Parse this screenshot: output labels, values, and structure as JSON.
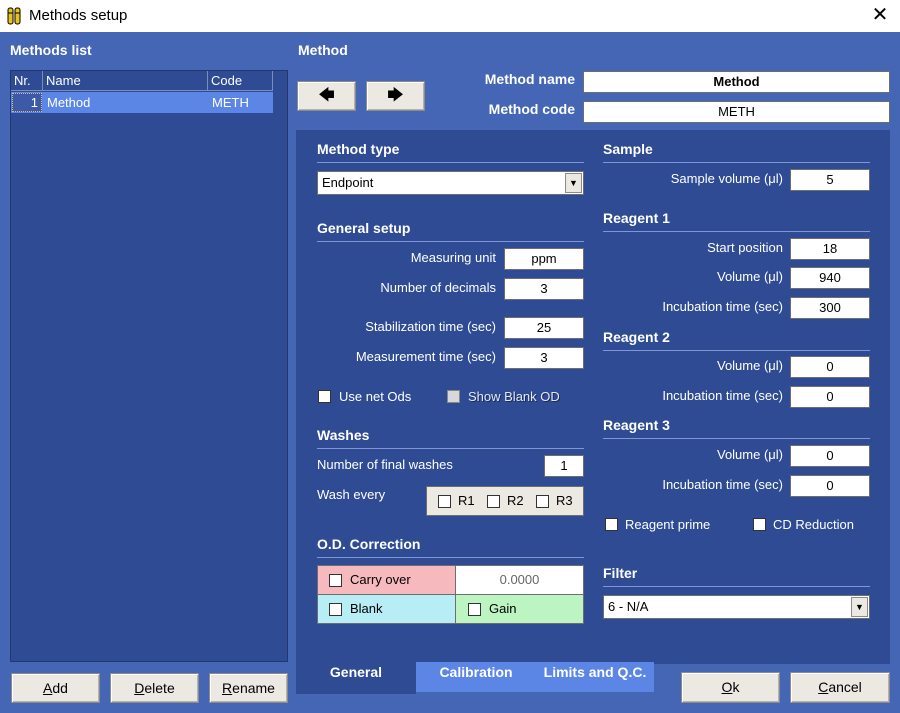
{
  "window": {
    "title": "Methods setup",
    "close_glyph": "✕"
  },
  "methods_list": {
    "title": "Methods list",
    "columns": [
      "Nr.",
      "Name",
      "Code"
    ],
    "rows": [
      {
        "nr": "1",
        "name": "Method",
        "code": "METH"
      }
    ]
  },
  "method": {
    "title": "Method",
    "prev_glyph": "🡄",
    "next_glyph": "🡆",
    "name_label": "Method name",
    "name_value": "Method",
    "code_label": "Method code",
    "code_value": "METH"
  },
  "method_type": {
    "title": "Method type",
    "selected": "Endpoint"
  },
  "general_setup": {
    "title": "General setup",
    "measuring_unit_label": "Measuring unit",
    "measuring_unit": "ppm",
    "decimals_label": "Number of decimals",
    "decimals": "3",
    "stabilization_label": "Stabilization time (sec)",
    "stabilization": "25",
    "measurement_label": "Measurement time (sec)",
    "measurement": "3",
    "use_net_ods": "Use net Ods",
    "show_blank_od": "Show Blank OD"
  },
  "washes": {
    "title": "Washes",
    "final_label": "Number of final washes",
    "final_value": "1",
    "every_label": "Wash every",
    "r1": "R1",
    "r2": "R2",
    "r3": "R3"
  },
  "od_correction": {
    "title": "O.D. Correction",
    "carry_over": "Carry over",
    "carry_over_value": "0.0000",
    "blank": "Blank",
    "gain": "Gain"
  },
  "sample": {
    "title": "Sample",
    "volume_label": "Sample volume (μl)",
    "volume": "5"
  },
  "reagent1": {
    "title": "Reagent 1",
    "start_label": "Start position",
    "start": "18",
    "volume_label": "Volume (μl)",
    "volume": "940",
    "incubation_label": "Incubation time (sec)",
    "incubation": "300"
  },
  "reagent2": {
    "title": "Reagent 2",
    "volume_label": "Volume (μl)",
    "volume": "0",
    "incubation_label": "Incubation time (sec)",
    "incubation": "0"
  },
  "reagent3": {
    "title": "Reagent 3",
    "volume_label": "Volume (μl)",
    "volume": "0",
    "incubation_label": "Incubation time (sec)",
    "incubation": "0"
  },
  "options": {
    "reagent_prime": "Reagent prime",
    "cd_reduction": "CD Reduction"
  },
  "filter": {
    "title": "Filter",
    "selected": "6 - N/A"
  },
  "tabs": [
    "General",
    "Calibration",
    "Limits and Q.C."
  ],
  "buttons": {
    "add_pre": "",
    "add_u": "A",
    "add_post": "dd",
    "delete_pre": "",
    "delete_u": "D",
    "delete_post": "elete",
    "rename_pre": "",
    "rename_u": "R",
    "rename_post": "ename",
    "ok_pre": "",
    "ok_u": "O",
    "ok_post": "k",
    "cancel_pre": "",
    "cancel_u": "C",
    "cancel_post": "ancel"
  },
  "colors": {
    "client_bg": "#4566b4",
    "panel_bg": "#2f4b94",
    "selection": "#5b86e6",
    "carry_over_bg": "#f6b9bd",
    "blank_bg": "#b7edf5",
    "gain_bg": "#bdf5c2",
    "tab_active": "#5b86e6"
  }
}
